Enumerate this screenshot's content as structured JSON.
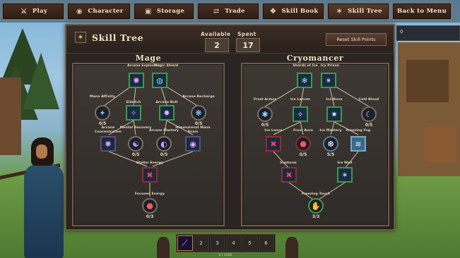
{
  "nav": [
    {
      "label": "Play",
      "icon": "crossed-swords-icon"
    },
    {
      "label": "Character",
      "icon": "character-icon"
    },
    {
      "label": "Storage",
      "icon": "chest-icon"
    },
    {
      "label": "Trade",
      "icon": "trade-icon"
    },
    {
      "label": "Skill Book",
      "icon": "book-icon"
    },
    {
      "label": "Skill Tree",
      "icon": "tree-icon"
    },
    {
      "label": "Back to Menu",
      "icon": ""
    }
  ],
  "side_field": {
    "value": "0"
  },
  "panel": {
    "title": "Skill Tree",
    "available_label": "Available",
    "available": "2",
    "spent_label": "Spent",
    "spent": "17",
    "reset_label": "Reset Skill Points"
  },
  "trees": [
    {
      "name": "Mage",
      "nodes": [
        {
          "label": "Arcane Explosion",
          "count": "",
          "icon": "arcane-explosion-icon"
        },
        {
          "label": "Magic Shield",
          "count": "",
          "icon": "magic-shield-icon"
        },
        {
          "label": "Mana Affinity",
          "count": "0/5",
          "icon": "mana-affinity-icon"
        },
        {
          "label": "Eldritch",
          "count": "",
          "icon": "eldritch-icon"
        },
        {
          "label": "Arcane Bolt",
          "count": "",
          "icon": "arcane-bolt-icon"
        },
        {
          "label": "Arcane Recharge",
          "count": "0/5",
          "icon": "arcane-recharge-icon"
        },
        {
          "label": "Arcane Concentration",
          "count": "",
          "icon": "arcane-concentration-icon"
        },
        {
          "label": "Mental Recovery",
          "count": "0/5",
          "icon": "mental-recovery-icon"
        },
        {
          "label": "Arcane Mastery",
          "count": "0/5",
          "icon": "arcane-mastery-icon"
        },
        {
          "label": "Dimensional Mana Drain",
          "count": "",
          "icon": "dimensional-drain-icon"
        },
        {
          "label": "Stellar Energy",
          "count": "",
          "icon": "stellar-energy-icon"
        },
        {
          "label": "Focused Energy",
          "count": "0/3",
          "icon": "focused-energy-icon"
        }
      ]
    },
    {
      "name": "Cryomancer",
      "nodes": [
        {
          "label": "Shards of Ice",
          "count": "",
          "icon": "ice-shards-icon"
        },
        {
          "label": "Icy Prison",
          "count": "",
          "icon": "icy-prison-icon"
        },
        {
          "label": "Frost Armor",
          "count": "0/5",
          "icon": "frost-armor-icon"
        },
        {
          "label": "Ice Lances",
          "count": "",
          "icon": "ice-lances-icon"
        },
        {
          "label": "Ice Nova",
          "count": "",
          "icon": "ice-nova-icon"
        },
        {
          "label": "Cold Blood",
          "count": "0/5",
          "icon": "cold-blood-icon"
        },
        {
          "label": "Ice Lance",
          "count": "",
          "icon": "ice-lance-icon"
        },
        {
          "label": "Frost Aura",
          "count": "0/5",
          "icon": "frost-aura-icon"
        },
        {
          "label": "Ice Mastery",
          "count": "5/5",
          "icon": "ice-mastery-icon"
        },
        {
          "label": "Freezing Fog",
          "count": "",
          "icon": "freezing-fog-icon"
        },
        {
          "label": "Icestorm",
          "count": "",
          "icon": "icestorm-icon"
        },
        {
          "label": "Ice Wall",
          "count": "",
          "icon": "ice-wall-icon"
        },
        {
          "label": "Freezing Touch",
          "count": "3/3",
          "icon": "freezing-touch-icon"
        }
      ]
    }
  ],
  "hotbar": {
    "slots": [
      "",
      "2",
      "3",
      "4",
      "5",
      "6"
    ],
    "xp_text": "0 / 4200"
  },
  "colors": {
    "learned_border": "#3d9a4a",
    "locked_border": "#9a2a2a",
    "panel_bg": "#2a2523",
    "frame": "#6e5a45"
  }
}
